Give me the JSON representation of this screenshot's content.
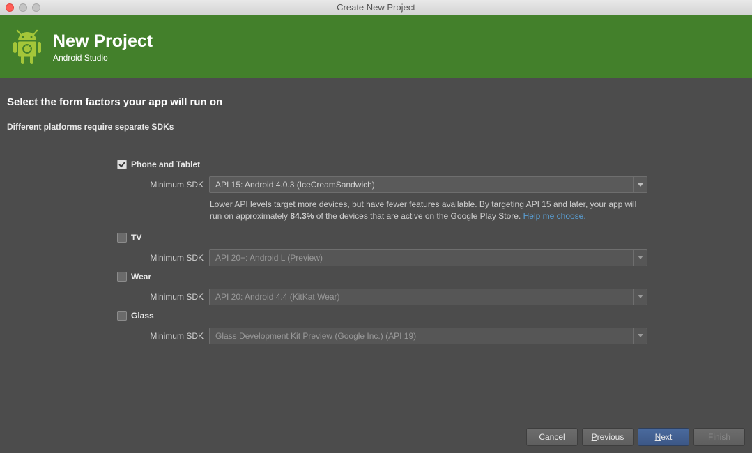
{
  "window": {
    "title": "Create New Project"
  },
  "header": {
    "title": "New Project",
    "subtitle": "Android Studio"
  },
  "section": {
    "title": "Select the form factors your app will run on",
    "subtitle": "Different platforms require separate SDKs"
  },
  "factors": {
    "phone": {
      "label": "Phone and Tablet",
      "sdk_label": "Minimum SDK",
      "sdk_value": "API 15: Android 4.0.3 (IceCreamSandwich)",
      "help_pre": "Lower API levels target more devices, but have fewer features available. By targeting API 15 and later, your app will run on approximately ",
      "help_percent": "84.3%",
      "help_post": " of the devices that are active on the Google Play Store. ",
      "help_link": "Help me choose."
    },
    "tv": {
      "label": "TV",
      "sdk_label": "Minimum SDK",
      "sdk_value": "API 20+: Android L (Preview)"
    },
    "wear": {
      "label": "Wear",
      "sdk_label": "Minimum SDK",
      "sdk_value": "API 20: Android 4.4 (KitKat Wear)"
    },
    "glass": {
      "label": "Glass",
      "sdk_label": "Minimum SDK",
      "sdk_value": "Glass Development Kit Preview (Google Inc.) (API 19)"
    }
  },
  "buttons": {
    "cancel": "Cancel",
    "previous_pre": "P",
    "previous_post": "revious",
    "next_pre": "N",
    "next_post": "ext",
    "finish": "Finish"
  }
}
